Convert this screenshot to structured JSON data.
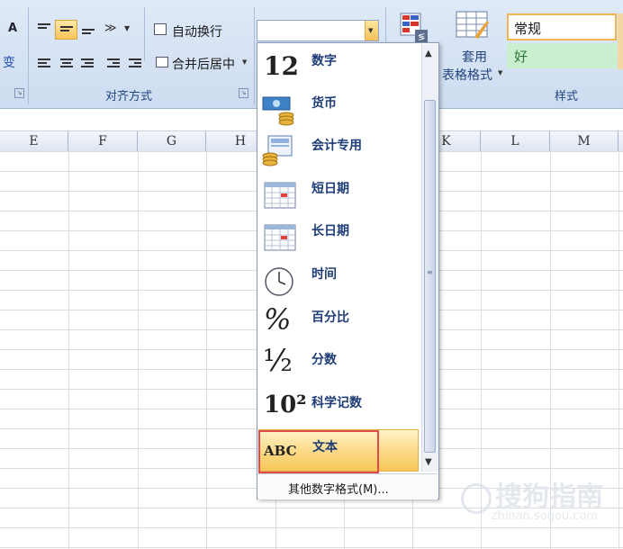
{
  "ribbon": {
    "wrap_text": "自动换行",
    "merge_center": "合并后居中",
    "alignment_group": "对齐方式",
    "styles_group": "样式",
    "table_format_line1": "套用",
    "table_format_line2": "表格格式",
    "style_normal": "常规",
    "style_good": "好",
    "font_size_up": "A",
    "orient_label": "变"
  },
  "columns": [
    "E",
    "F",
    "G",
    "H",
    "K",
    "L",
    "M"
  ],
  "number_format_menu": {
    "current_value": "",
    "items": [
      {
        "icon": "12",
        "label": "数字"
      },
      {
        "icon": "currency-icon",
        "label": "货币"
      },
      {
        "icon": "accounting-icon",
        "label": "会计专用"
      },
      {
        "icon": "calendar-icon",
        "label": "短日期"
      },
      {
        "icon": "calendar-icon",
        "label": "长日期"
      },
      {
        "icon": "clock-icon",
        "label": "时间"
      },
      {
        "icon": "%",
        "label": "百分比"
      },
      {
        "icon": "½",
        "label": "分数"
      },
      {
        "icon": "10²",
        "label": "科学记数"
      },
      {
        "icon": "ABC",
        "label": "文本"
      }
    ],
    "selected_index": 9,
    "more_formats": "其他数字格式(M)..."
  },
  "watermark": {
    "brand": "搜狗指南",
    "url": "zhinan.sogou.com"
  },
  "colors": {
    "ribbon_bg": "#dfeaf8",
    "menu_label": "#1f3d77",
    "selected_item": "#fbd983",
    "highlight_border": "#e04a4a"
  }
}
